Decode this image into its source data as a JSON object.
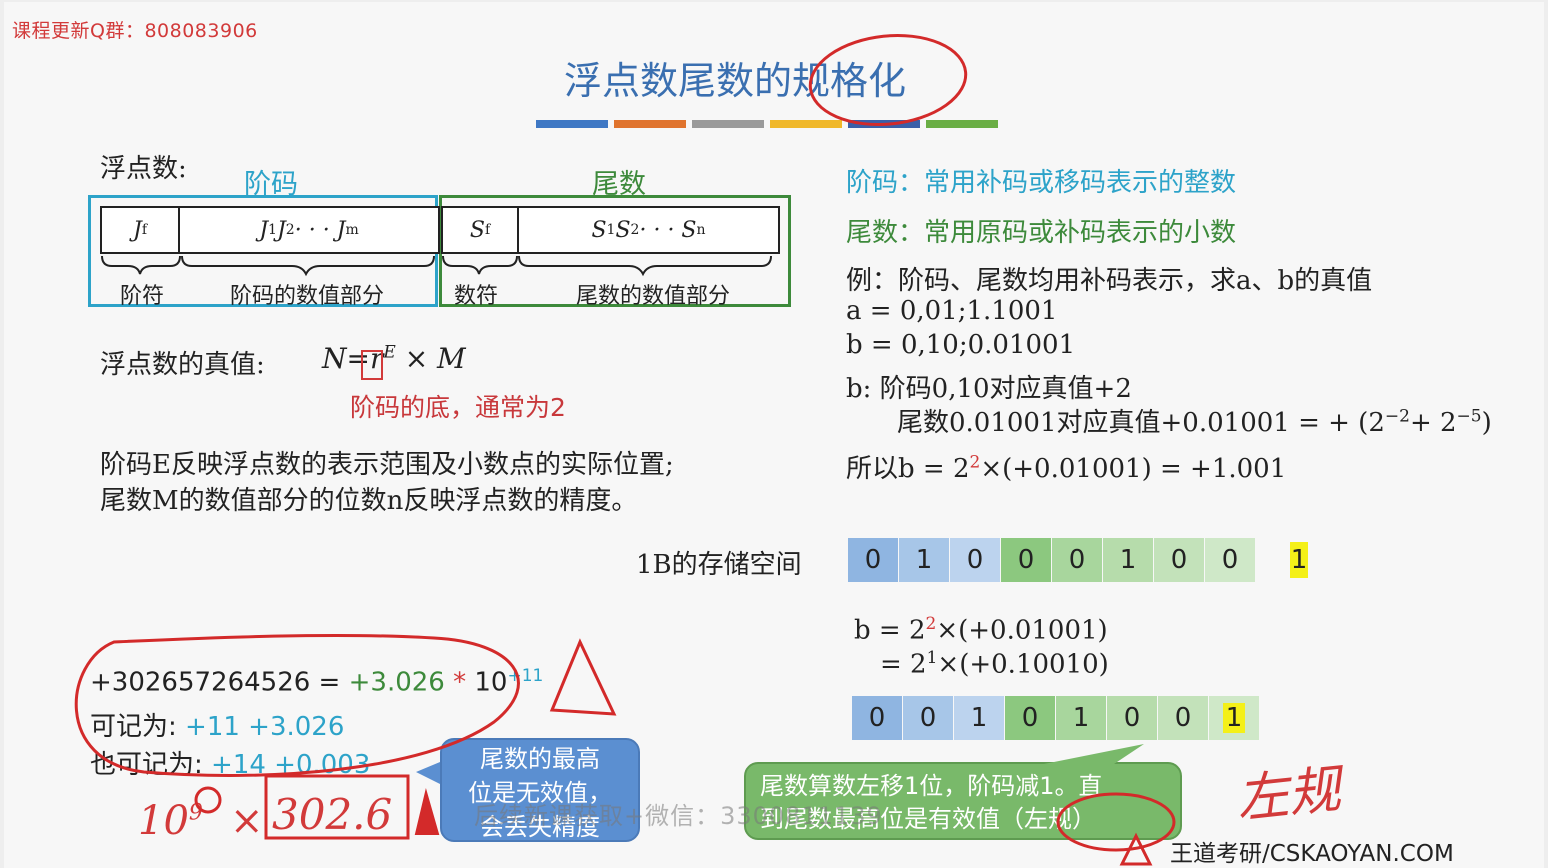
{
  "watermark_top": "课程更新Q群：808083906",
  "faded_logo": "",
  "title": "浮点数尾数的规格化",
  "title_bar_colors": [
    "#3f78c4",
    "#e0742e",
    "#9a9a9a",
    "#f0b82a",
    "#3a5fa8",
    "#6aae45"
  ],
  "left": {
    "fp_label": "浮点数:",
    "exp_header": "阶码",
    "mant_header": "尾数",
    "cells": {
      "jf": "J",
      "jf_sub": "f",
      "jbits": "J",
      "jbits_sub1": "1",
      "jbits_mid": "J",
      "jbits_sub2": "2",
      "jbits_dots": " · · · J",
      "jbits_subm": "m",
      "sf": "S",
      "sf_sub": "f",
      "sbits": "S",
      "sbits_sub1": "1",
      "sbits_mid": "S",
      "sbits_sub2": "2",
      "sbits_dots": "· · · S",
      "sbits_subn": "n"
    },
    "brace_labels": {
      "exp_sign": "阶符",
      "exp_value": "阶码的数值部分",
      "mant_sign": "数符",
      "mant_value": "尾数的数值部分"
    },
    "truth_label": "浮点数的真值:",
    "formula_n": "N",
    "formula_eq": "=",
    "formula_r": "r",
    "formula_e": "E",
    "formula_tail": "× M",
    "base_note": "阶码的底，通常为2",
    "desc1": "阶码E反映浮点数的表示范围及小数点的实际位置;",
    "desc2": "尾数M的数值部分的位数n反映浮点数的精度。"
  },
  "right": {
    "exp_desc": "阶码：常用补码或移码表示的整数",
    "mant_desc": "尾数：常用原码或补码表示的小数",
    "example": "例：阶码、尾数均用补码表示，求a、b的真值",
    "a_val": "a = 0,01;1.1001",
    "b_val": "b = 0,10;0.01001",
    "b_line1": "b:   阶码0,10对应真值+2",
    "b_line2_pre": "尾数0.01001对应真值+0.01001 = + (2",
    "b_line2_sup1": "−2",
    "b_line2_mid": "+ 2",
    "b_line2_sup2": "−5",
    "b_line2_end": ")",
    "b_line3_pre": "所以b = 2",
    "b_line3_sup": "2",
    "b_line3_end": "×(+0.01001) = +1.001"
  },
  "storage": {
    "label": "1B的存储空间",
    "bits": [
      "0",
      "1",
      "0",
      "0",
      "0",
      "1",
      "0",
      "0"
    ],
    "bit_colors": [
      "#8fb5e1",
      "#a7c6e8",
      "#bcd3ee",
      "#8cc87f",
      "#a8d69d",
      "#b6dcab",
      "#c3e2ba",
      "#cfe8c8"
    ],
    "extra_bit": "1"
  },
  "normalized": {
    "line1_pre": "b = 2",
    "line1_sup": "2",
    "line1_end": "×(+0.01001)",
    "line2_pre": "= 2",
    "line2_sup": "1",
    "line2_end": "×(+0.10010)",
    "bits": [
      "0",
      "0",
      "1",
      "0",
      "1",
      "0",
      "0",
      "1"
    ],
    "bit_colors": [
      "#8fb5e1",
      "#a7c6e8",
      "#bcd3ee",
      "#8cc87f",
      "#a8d69d",
      "#b6dcab",
      "#c3e2ba",
      "#cfe8c8"
    ],
    "highlight_index": 7,
    "highlight_color": "#f4f018"
  },
  "example_left": {
    "line1_num": "+302657264526",
    "line1_eq": " = ",
    "line1_mant": "+3.026",
    "line1_op": " * ",
    "line1_ten": "10",
    "line1_exp": "+11",
    "line2_label": "可记为:",
    "line2_val": "+11 +3.026",
    "line3_label": "也可记为:",
    "line3_val": "+14 +0.003"
  },
  "handwritten": {
    "ten": "10",
    "ten_exp": "9",
    "times": "×",
    "boxed_num": "302.6",
    "right_note": "左规"
  },
  "callouts": {
    "blue": [
      "尾数的最高",
      "位是无效值，",
      "会丢失精度"
    ],
    "green": [
      "尾数算数左移1位，阶码减1。直",
      "到尾数最高位是有效值（左规）"
    ]
  },
  "overlay_watermark": "后续新课获取+微信：3300811139",
  "brand": "王道考研/CSKAOYAN.COM"
}
